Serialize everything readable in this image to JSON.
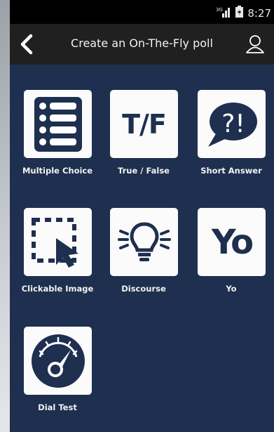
{
  "status": {
    "network": "3G",
    "time": "8:27"
  },
  "header": {
    "title": "Create an On-The-Fly poll"
  },
  "icons": {
    "back": "chevron-left-icon",
    "user": "user-icon",
    "battery": "battery-icon",
    "signal": "signal-icon"
  },
  "poll_types": [
    {
      "label": "Multiple Choice",
      "icon": "list-icon"
    },
    {
      "label": "True / False",
      "icon_text": "T/F"
    },
    {
      "label": "Short Answer",
      "icon_text": "?!"
    },
    {
      "label": "Clickable Image",
      "icon": "cursor-select-icon"
    },
    {
      "label": "Discourse",
      "icon": "lightbulb-icon"
    },
    {
      "label": "Yo",
      "icon_text": "Yo"
    },
    {
      "label": "Dial Test",
      "icon": "dial-gauge-icon"
    }
  ],
  "colors": {
    "background": "#1e2f4f",
    "appbar": "#202020",
    "tile": "#fbfbfb"
  }
}
